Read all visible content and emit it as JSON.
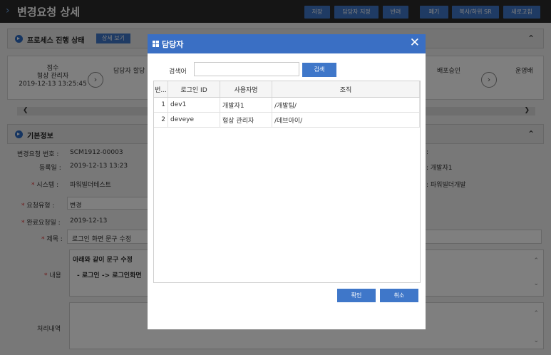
{
  "page": {
    "title": "변경요청 상세"
  },
  "toolbar": {
    "save": "저장",
    "assign": "담당자 지정",
    "reject": "반려",
    "discard": "폐기",
    "copy": "복사/하위 SR",
    "refresh": "새로고침"
  },
  "process": {
    "title": "프로세스 진행 상태",
    "detail_button": "상세 보기",
    "steps": [
      {
        "name": "접수",
        "person": "형상 관리자",
        "time": "2019-12-13 13:25:45"
      },
      {
        "name": "담당자 할당"
      },
      {
        "name": "배포승인"
      },
      {
        "name": "운영배"
      }
    ]
  },
  "basic": {
    "title": "기본정보",
    "fields": {
      "cr_no": {
        "label": "변경요청 번호 :",
        "value": "SCM1912-00003"
      },
      "reg_date": {
        "label": "등록일 :",
        "value": "2019-12-13 13:23"
      },
      "system": {
        "label": "시스템 :",
        "value": "파워빌더테스트"
      },
      "req_type": {
        "label": "요청유형 :",
        "value": "변경"
      },
      "due_date": {
        "label": "완료요청일 :",
        "value": "2019-12-13"
      },
      "subject": {
        "label": "제목 :",
        "value": "로그인 화면 문구 수정"
      },
      "content": {
        "label": "내용",
        "line1": "아래와 같이 문구 수정",
        "line2": "- 로그인 -> 로그인화면"
      },
      "history": {
        "label": "처리내역"
      },
      "right_colon": ":",
      "right_person": ": 개발자1",
      "right_team": ": 파워빌더개발"
    }
  },
  "modal": {
    "title": "담당자",
    "search_label": "검색어",
    "search_value": "",
    "search_button": "검색",
    "columns": [
      "번...",
      "로그인 ID",
      "사용자명",
      "조직"
    ],
    "rows": [
      {
        "no": "1",
        "id": "dev1",
        "name": "개발자1",
        "org": "/개발팀/"
      },
      {
        "no": "2",
        "id": "deveye",
        "name": "형상 관리자",
        "org": "/데브아이/"
      }
    ],
    "ok": "확인",
    "cancel": "취소"
  },
  "colors": {
    "accent": "#3f77c9",
    "topbar": "#2b2b2b",
    "modal_header": "#3a6fc4"
  }
}
